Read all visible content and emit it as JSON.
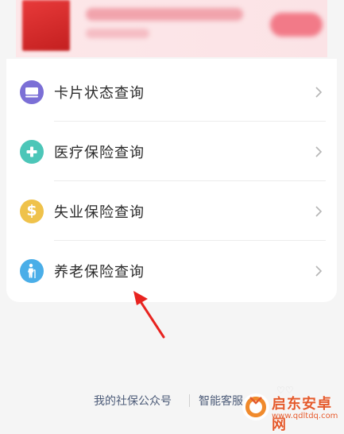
{
  "menu": {
    "items": [
      {
        "label": "卡片状态查询",
        "icon": "card-icon",
        "color": "#7b6fd6"
      },
      {
        "label": "医疗保险查询",
        "icon": "medical-cross-icon",
        "color": "#4cc6b8"
      },
      {
        "label": "失业保险查询",
        "icon": "dollar-icon",
        "color": "#efc24b"
      },
      {
        "label": "养老保险查询",
        "icon": "elderly-person-icon",
        "color": "#4aaee8"
      }
    ]
  },
  "footer": {
    "link1": "我的社保公众号",
    "link2": "智能客服"
  },
  "watermark": {
    "title": "启东安卓网",
    "url": "www.qdltdq.com"
  },
  "colors": {
    "annotation_arrow": "#e8231f",
    "watermark": "#e45a2c"
  }
}
